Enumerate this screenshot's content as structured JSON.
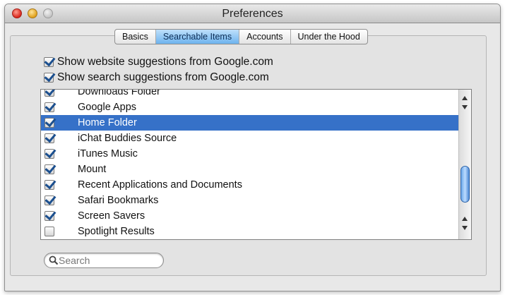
{
  "window": {
    "title": "Preferences"
  },
  "tabs": [
    {
      "label": "Basics",
      "active": false
    },
    {
      "label": "Searchable Items",
      "active": true
    },
    {
      "label": "Accounts",
      "active": false
    },
    {
      "label": "Under the Hood",
      "active": false
    }
  ],
  "options": {
    "website_suggestions": {
      "label": "Show website suggestions from Google.com",
      "checked": true
    },
    "search_suggestions": {
      "label": "Show search suggestions from Google.com",
      "checked": true
    }
  },
  "items": [
    {
      "label": "Downloads Folder",
      "checked": true,
      "selected": false
    },
    {
      "label": "Google Apps",
      "checked": true,
      "selected": false
    },
    {
      "label": "Home Folder",
      "checked": true,
      "selected": true
    },
    {
      "label": "iChat Buddies Source",
      "checked": true,
      "selected": false
    },
    {
      "label": "iTunes Music",
      "checked": true,
      "selected": false
    },
    {
      "label": "Mount",
      "checked": true,
      "selected": false
    },
    {
      "label": "Recent Applications and Documents",
      "checked": true,
      "selected": false
    },
    {
      "label": "Safari Bookmarks",
      "checked": true,
      "selected": false
    },
    {
      "label": "Screen Savers",
      "checked": true,
      "selected": false
    },
    {
      "label": "Spotlight Results",
      "checked": false,
      "selected": false
    }
  ],
  "search": {
    "placeholder": "Search",
    "value": ""
  },
  "colors": {
    "selection": "#3671c8",
    "active_tab": "#6db3ee"
  }
}
